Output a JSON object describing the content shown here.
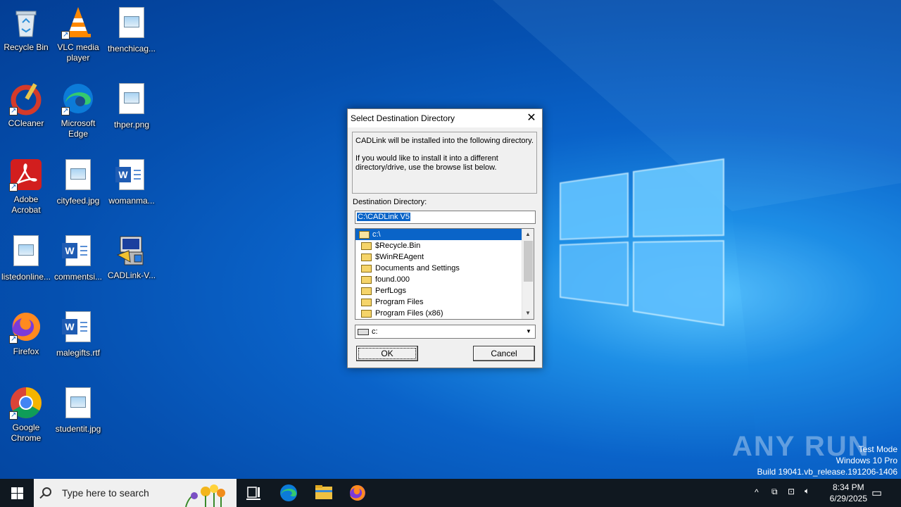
{
  "desktop": {
    "icons": [
      {
        "label": "Recycle Bin"
      },
      {
        "label": "VLC media player"
      },
      {
        "label": "thenchicag..."
      },
      {
        "label": "CCleaner"
      },
      {
        "label": "Microsoft Edge"
      },
      {
        "label": "thper.png"
      },
      {
        "label": "Adobe Acrobat"
      },
      {
        "label": "cityfeed.jpg"
      },
      {
        "label": "womanma..."
      },
      {
        "label": "listedonline..."
      },
      {
        "label": "commentsi..."
      },
      {
        "label": "CADLink-V..."
      },
      {
        "label": "Firefox"
      },
      {
        "label": "malegifts.rtf"
      },
      {
        "label": "Google Chrome"
      },
      {
        "label": "studentit.jpg"
      }
    ]
  },
  "dialog": {
    "title": "Select Destination Directory",
    "close_glyph": "✕",
    "info_line1": "CADLink will be installed into the following directory.",
    "info_line2": "If you would like to install it into a different directory/drive, use the browse list below.",
    "dest_label": "Destination Directory:",
    "dest_value": "C:\\CADLink V5",
    "folders": [
      {
        "name": "c:\\"
      },
      {
        "name": "$Recycle.Bin"
      },
      {
        "name": "$WinREAgent"
      },
      {
        "name": "Documents and Settings"
      },
      {
        "name": "found.000"
      },
      {
        "name": "PerfLogs"
      },
      {
        "name": "Program Files"
      },
      {
        "name": "Program Files (x86)"
      }
    ],
    "drive": "c:",
    "ok_label": "OK",
    "cancel_label": "Cancel"
  },
  "watermark": {
    "brand": "ANY RUN",
    "line1": "Test Mode",
    "line2": "Windows 10 Pro",
    "line3": "Build 19041.vb_release.191206-1406"
  },
  "taskbar": {
    "search_placeholder": "Type here to search",
    "time": "8:34 PM",
    "date": "6/29/2025"
  },
  "colors": {
    "selection": "#0a64c8",
    "taskbar": "#101820"
  }
}
